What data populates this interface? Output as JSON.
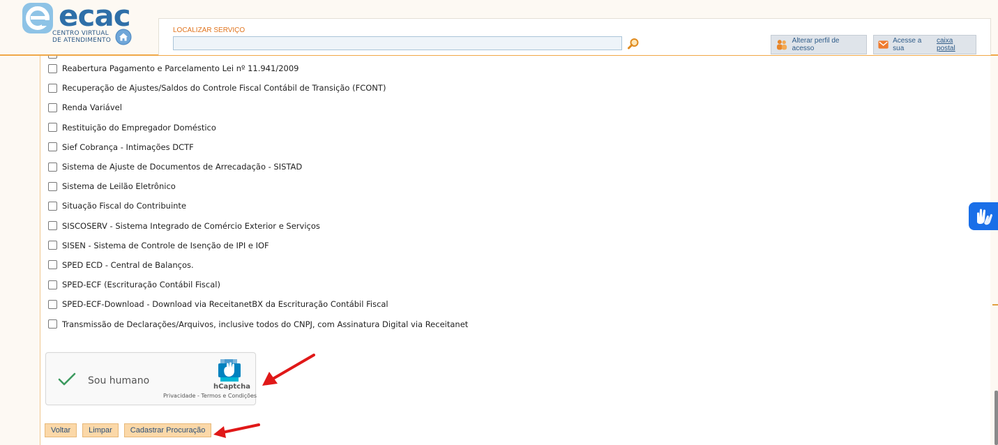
{
  "header": {
    "logo_word": "ecac",
    "logo_sub_line1": "CENTRO VIRTUAL",
    "logo_sub_line2": "DE ATENDIMENTO",
    "search_label": "LOCALIZAR SERVIÇO",
    "search_value": "",
    "profile_button": "Alterar perfil de acesso",
    "mail_prefix": "Acesse a sua",
    "mail_link": "caixa postal"
  },
  "services": [
    "Reabertura Pagamento e Parcelamento Lei nº 11.941/2009",
    "Recuperação de Ajustes/Saldos do Controle Fiscal Contábil de Transição (FCONT)",
    "Renda Variável",
    "Restituição do Empregador Doméstico",
    "Sief Cobrança - Intimações DCTF",
    "Sistema de Ajuste de Documentos de Arrecadação - SISTAD",
    "Sistema de Leilão Eletrônico",
    "Situação Fiscal do Contribuinte",
    "SISCOSERV - Sistema Integrado de Comércio Exterior e Serviços",
    "SISEN - Sistema de Controle de Isenção de IPI e IOF",
    "SPED ECD - Central de Balanços.",
    "SPED-ECF (Escrituração Contábil Fiscal)",
    "SPED-ECF-Download - Download via ReceitanetBX da Escrituração Contábil Fiscal",
    "Transmissão de Declarações/Arquivos, inclusive todos do CNPJ, com Assinatura Digital via Receitanet"
  ],
  "captcha": {
    "label": "Sou humano",
    "brand": "hCaptcha",
    "links": "Privacidade - Termos e Condições",
    "checked": true
  },
  "buttons": {
    "back": "Voltar",
    "clear": "Limpar",
    "submit": "Cadastrar Procuração"
  },
  "colors": {
    "accent_orange": "#f0a848",
    "link_blue": "#2e5b88",
    "annotation_red": "#e01818",
    "accessibility_blue": "#1a6fe8"
  }
}
